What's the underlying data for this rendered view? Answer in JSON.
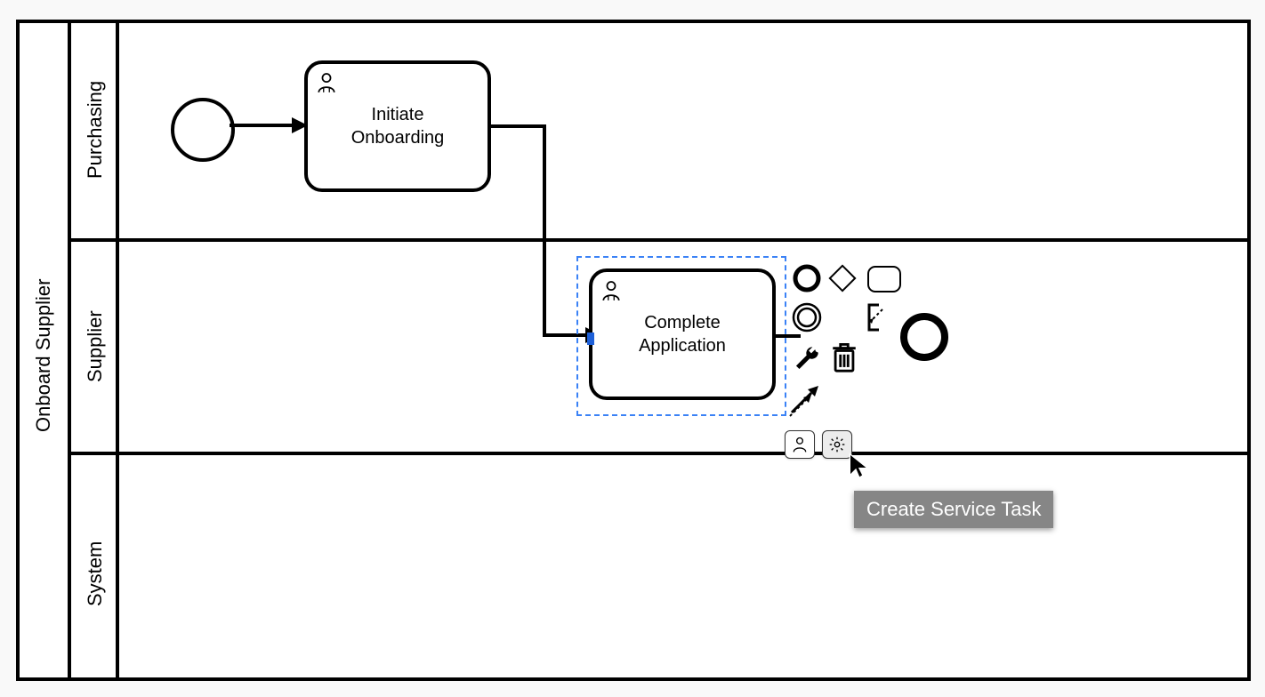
{
  "pool": {
    "title": "Onboard Supplier"
  },
  "lanes": [
    {
      "title": "Purchasing"
    },
    {
      "title": "Supplier"
    },
    {
      "title": "System"
    }
  ],
  "tasks": {
    "initiate": {
      "line1": "Initiate",
      "line2": "Onboarding"
    },
    "complete": {
      "line1": "Complete",
      "line2": "Application"
    }
  },
  "context_pad": {
    "event_icon": "event",
    "gateway_icon": "gateway",
    "task_icon": "task",
    "intermediate_icon": "intermediate-event",
    "text_annotation_icon": "text-annotation",
    "end_event_icon": "end-event",
    "wrench_icon": "wrench",
    "trash_icon": "trash",
    "connect_icon": "connect"
  },
  "speed_buttons": {
    "user_task": "Create User Task",
    "service_task": "Create Service Task"
  },
  "tooltip": "Create Service Task"
}
